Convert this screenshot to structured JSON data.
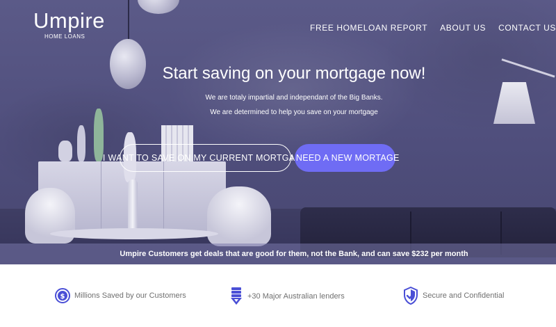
{
  "brand": {
    "name": "Umpire",
    "tagline": "HOME LOANS"
  },
  "nav": {
    "items": [
      {
        "label": "FREE HOMELOAN REPORT"
      },
      {
        "label": "ABOUT US"
      },
      {
        "label": "CONTACT US"
      }
    ]
  },
  "hero": {
    "headline": "Start saving on your mortgage now!",
    "subline_1": "We are totaly impartial and independant of the Big Banks.",
    "subline_2": "We are determined to help you save on your mortgage",
    "button_current": "I WANT TO SAVE ON MY CURRENT MORTGAGE",
    "button_new": "I NEED A NEW MORTAGE"
  },
  "banner": {
    "text": "Umpire Customers get deals that are good for them, not the Bank, and can save $232 per month"
  },
  "features": [
    {
      "icon": "dollar-coin-icon",
      "label": "Millions Saved by our Customers"
    },
    {
      "icon": "bank-stack-icon",
      "label": "+30 Major Australian lenders"
    },
    {
      "icon": "shield-check-icon",
      "label": "Secure and Confidential"
    }
  ],
  "colors": {
    "accent": "#6f6cf4",
    "hero_overlay": "#5b5a88",
    "icon_blue": "#4a4fd6",
    "feature_text": "#707070"
  }
}
